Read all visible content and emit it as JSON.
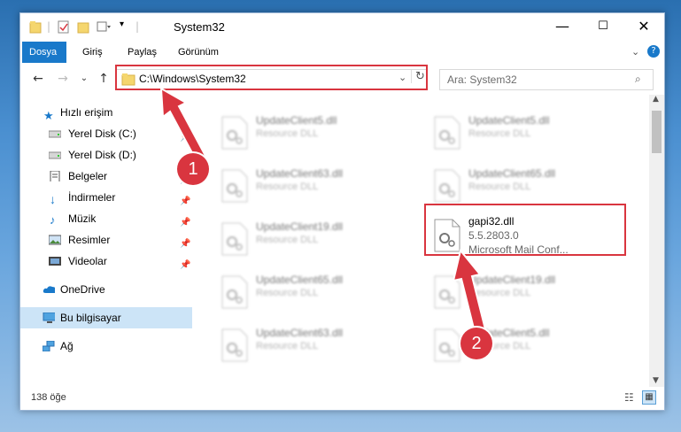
{
  "window": {
    "title": "System32"
  },
  "ribbon": {
    "tabs": [
      {
        "label": "Dosya",
        "active": true
      },
      {
        "label": "Giriş"
      },
      {
        "label": "Paylaş"
      },
      {
        "label": "Görünüm"
      }
    ]
  },
  "address": {
    "path": "C:\\Windows\\System32"
  },
  "search": {
    "placeholder": "Ara: System32"
  },
  "nav": {
    "items": [
      {
        "label": "Hızlı erişim",
        "icon": "star-icon"
      },
      {
        "label": "Yerel Disk (C:)",
        "icon": "drive-icon",
        "pinned": true
      },
      {
        "label": "Yerel Disk (D:)",
        "icon": "drive-icon",
        "pinned": true
      },
      {
        "label": "Belgeler",
        "icon": "documents-icon",
        "pinned": true
      },
      {
        "label": "İndirmeler",
        "icon": "download-icon",
        "pinned": true
      },
      {
        "label": "Müzik",
        "icon": "music-icon",
        "pinned": true
      },
      {
        "label": "Resimler",
        "icon": "pictures-icon",
        "pinned": true
      },
      {
        "label": "Videolar",
        "icon": "videos-icon",
        "pinned": true
      },
      {
        "label": "OneDrive",
        "icon": "cloud-icon"
      },
      {
        "label": "Bu bilgisayar",
        "icon": "computer-icon",
        "selected": true
      },
      {
        "label": "Ağ",
        "icon": "network-icon"
      }
    ]
  },
  "files": [
    {
      "name": "UpdateClient5.dll",
      "type": "Resource DLL"
    },
    {
      "name": "UpdateClient5.dll",
      "type": "Resource DLL"
    },
    {
      "name": "UpdateClient63.dll",
      "type": "Resource DLL"
    },
    {
      "name": "UpdateClient65.dll",
      "type": "Resource DLL"
    },
    {
      "name": "UpdateClient19.dll",
      "type": "Resource DLL"
    },
    {
      "name": "gapi32.dll",
      "version": "5.5.2803.0",
      "desc": "Microsoft Mail Conf..."
    },
    {
      "name": "UpdateClient65.dll",
      "type": "Resource DLL"
    },
    {
      "name": "UpdateClient19.dll",
      "type": "Resource DLL"
    },
    {
      "name": "UpdateClient63.dll",
      "type": "Resource DLL"
    },
    {
      "name": "UpdateClient5.dll",
      "type": "Resource DLL"
    }
  ],
  "status": {
    "count": "138 öğe"
  },
  "annotations": {
    "step1": "1",
    "step2": "2"
  },
  "colors": {
    "accent": "#1979ca",
    "highlight": "#d9353f",
    "selection": "#cce4f7"
  }
}
